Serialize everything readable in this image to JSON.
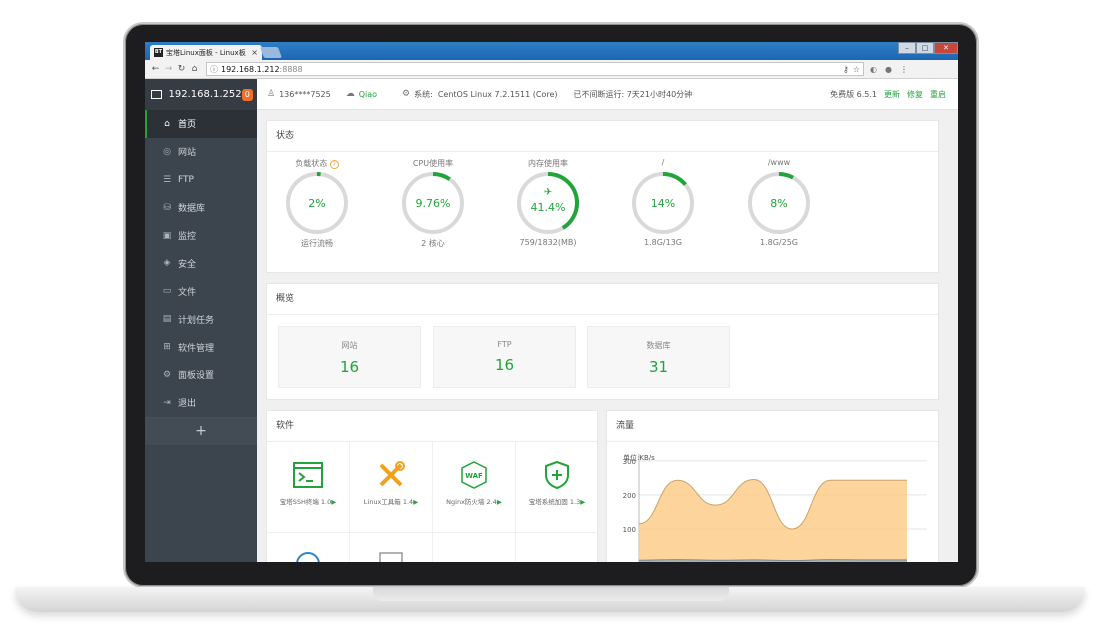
{
  "browser": {
    "tab_title": "宝塔Linux面板 - Linux板",
    "tab_favicon": "BT",
    "close_glyph": "×",
    "address_host": "192.168.1.212",
    "address_port": ":8888"
  },
  "sidebar": {
    "server_ip": "192.168.1.252",
    "badge": "0",
    "items": [
      {
        "label": "首页",
        "icon": "home-icon",
        "glyph": "⌂",
        "active": true
      },
      {
        "label": "网站",
        "icon": "globe-icon",
        "glyph": "◎"
      },
      {
        "label": "FTP",
        "icon": "ftp-icon",
        "glyph": "☰"
      },
      {
        "label": "数据库",
        "icon": "database-icon",
        "glyph": "⛁"
      },
      {
        "label": "监控",
        "icon": "monitor-icon",
        "glyph": "▣"
      },
      {
        "label": "安全",
        "icon": "shield-icon",
        "glyph": "◈"
      },
      {
        "label": "文件",
        "icon": "folder-icon",
        "glyph": "▭"
      },
      {
        "label": "计划任务",
        "icon": "calendar-icon",
        "glyph": "▤"
      },
      {
        "label": "软件管理",
        "icon": "grid-icon",
        "glyph": "⊞"
      },
      {
        "label": "面板设置",
        "icon": "gear-icon",
        "glyph": "⚙"
      },
      {
        "label": "退出",
        "icon": "logout-icon",
        "glyph": "⇥"
      }
    ],
    "add_label": "+"
  },
  "topbar": {
    "user": "136****7525",
    "bound_user": "Qiao",
    "system_label": "系统:",
    "system_os": "CentOS Linux 7.2.1511 (Core)",
    "uptime": "已不间断运行: 7天21小时40分钟",
    "edition": "免费版 6.5.1",
    "update_label": "更新",
    "repair_label": "修复",
    "restart_label": "重启"
  },
  "status": {
    "title": "状态",
    "gauges": [
      {
        "label": "负载状态",
        "value": "2%",
        "percent": 2,
        "sub": "运行流畅",
        "help": "?"
      },
      {
        "label": "CPU使用率",
        "value": "9.76%",
        "percent": 9.76,
        "sub": "2 核心"
      },
      {
        "label": "内存使用率",
        "value": "41.4%",
        "percent": 41.4,
        "sub": "759/1832(MB)",
        "icon": "rocket-icon"
      },
      {
        "label": "/",
        "value": "14%",
        "percent": 14,
        "sub": "1.8G/13G"
      },
      {
        "label": "/www",
        "value": "8%",
        "percent": 8,
        "sub": "1.8G/25G"
      }
    ]
  },
  "overview": {
    "title": "概览",
    "cards": [
      {
        "label": "网站",
        "value": "16"
      },
      {
        "label": "FTP",
        "value": "16"
      },
      {
        "label": "数据库",
        "value": "31"
      }
    ]
  },
  "software": {
    "title": "软件",
    "items": [
      {
        "label": "宝塔SSH终端 1.0",
        "icon": "terminal-icon"
      },
      {
        "label": "Linux工具箱 1.4",
        "icon": "tools-icon"
      },
      {
        "label": "Nginx防火墙 2.4",
        "icon": "waf-icon",
        "icon_text": "WAF"
      },
      {
        "label": "宝塔系统加固 1.3",
        "icon": "shield-plus-icon"
      }
    ],
    "arrow": "▶"
  },
  "traffic": {
    "title": "流量",
    "chart_data": {
      "type": "area",
      "ylabel": "单位:KB/s",
      "yticks": [
        100,
        200,
        300
      ],
      "ylim": [
        0,
        320
      ],
      "series": [
        {
          "values": [
            115,
            243,
            170,
            245,
            100,
            243,
            243,
            243
          ],
          "color": "#fbcd8b"
        },
        {
          "values": [
            8,
            10,
            8,
            9,
            7,
            10,
            9,
            9
          ],
          "color": "#9aa9b6"
        }
      ]
    }
  }
}
